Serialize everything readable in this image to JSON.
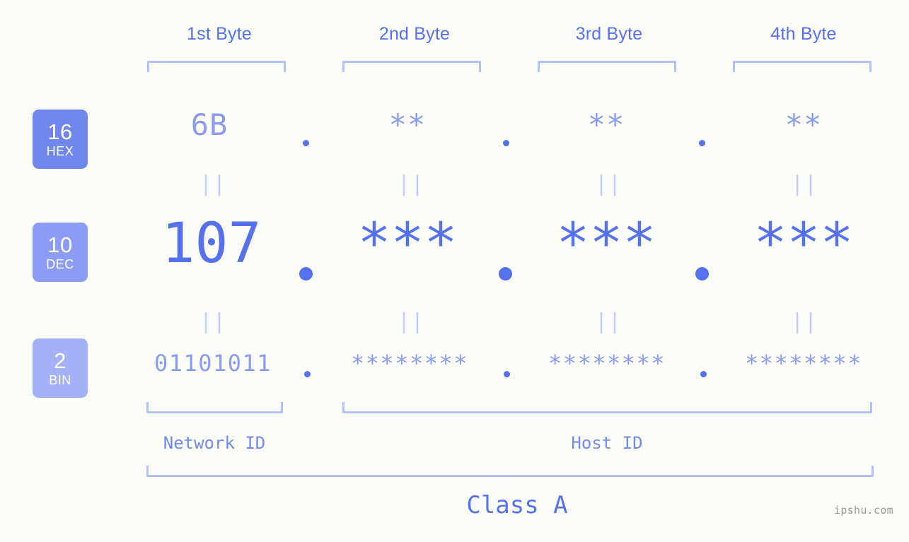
{
  "page": {
    "background_color": "#fcfdf9",
    "watermark": "ipshu.com"
  },
  "colors": {
    "accent_strong": "#5571ec",
    "accent_mid": "#8b9bf2",
    "accent_light": "#b4c0fb",
    "connector": "#c4cdfb",
    "badge_hex": "#7087ee",
    "badge_dec": "#8b9cf4",
    "badge_bin": "#a3b2f8",
    "watermark": "#9a9a9a"
  },
  "header": {
    "bytes": [
      {
        "label": "1st Byte"
      },
      {
        "label": "2nd Byte"
      },
      {
        "label": "3rd Byte"
      },
      {
        "label": "4th Byte"
      }
    ]
  },
  "radix_badges": [
    {
      "number": "16",
      "name": "HEX"
    },
    {
      "number": "10",
      "name": "DEC"
    },
    {
      "number": "2",
      "name": "BIN"
    }
  ],
  "rows": {
    "hex": {
      "radix": "16",
      "name": "HEX",
      "octets": [
        "6B",
        "**",
        "**",
        "**"
      ],
      "separator": "."
    },
    "dec": {
      "radix": "10",
      "name": "DEC",
      "octets": [
        "107",
        "***",
        "***",
        "***"
      ],
      "separator": "."
    },
    "bin": {
      "radix": "2",
      "name": "BIN",
      "octets": [
        "01101011",
        "********",
        "********",
        "********"
      ],
      "separator": "."
    }
  },
  "connectors": {
    "symbol": "||"
  },
  "footer": {
    "network_id_label": "Network ID",
    "host_id_label": "Host ID",
    "class_label": "Class A"
  }
}
